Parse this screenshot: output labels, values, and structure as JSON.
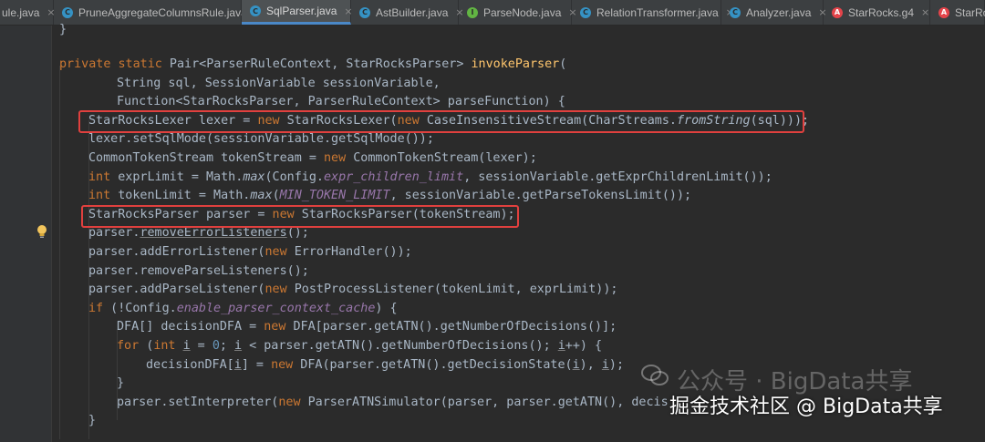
{
  "tabs": [
    {
      "label": "ule.java",
      "icon": "java-class-icon",
      "active": false
    },
    {
      "label": "PruneAggregateColumnsRule.java",
      "icon": "java-class-icon",
      "active": false
    },
    {
      "label": "SqlParser.java",
      "icon": "java-class-icon",
      "active": true
    },
    {
      "label": "AstBuilder.java",
      "icon": "java-class-icon",
      "active": false
    },
    {
      "label": "ParseNode.java",
      "icon": "java-interface-icon",
      "active": false
    },
    {
      "label": "RelationTransformer.java",
      "icon": "java-class-icon",
      "active": false
    },
    {
      "label": "Analyzer.java",
      "icon": "java-class-icon",
      "active": false
    },
    {
      "label": "StarRocks.g4",
      "icon": "antlr-icon",
      "active": false
    },
    {
      "label": "StarRoc",
      "icon": "antlr-icon",
      "active": false
    }
  ],
  "colors": {
    "keyword": "#cc7832",
    "method_decl": "#ffc66d",
    "static_field": "#9876aa",
    "text": "#a9b7c6",
    "highlight_box": "#e0403e",
    "background": "#2b2b2b"
  },
  "code": {
    "l00": [
      "}"
    ],
    "l02": [
      "private static",
      " Pair<ParserRuleContext, StarRocksParser> ",
      "invokeParser",
      "("
    ],
    "l03": [
      "String sql, SessionVariable sessionVariable,"
    ],
    "l04": [
      "Function<StarRocksParser, ParserRuleContext> parseFunction) {"
    ],
    "l05": [
      "StarRocksLexer lexer = ",
      "new",
      " StarRocksLexer(",
      "new",
      " CaseInsensitiveStream(CharStreams.",
      "fromString",
      "(sql)));"
    ],
    "l06": [
      "lexer.setSqlMode(sessionVariable.getSqlMode());"
    ],
    "l07": [
      "CommonTokenStream tokenStream = ",
      "new",
      " CommonTokenStream(lexer);"
    ],
    "l08": [
      "int",
      " exprLimit = Math.",
      "max",
      "(Config.",
      "expr_children_limit",
      ", sessionVariable.getExprChildrenLimit());"
    ],
    "l09": [
      "int",
      " tokenLimit = Math.",
      "max",
      "(",
      "MIN_TOKEN_LIMIT",
      ", sessionVariable.getParseTokensLimit());"
    ],
    "l10": [
      "StarRocksParser parser = ",
      "new",
      " StarRocksParser(tokenStream);"
    ],
    "l11": [
      "parser.",
      "removeErrorListeners",
      "();"
    ],
    "l12": [
      "parser.addErrorListener(",
      "new",
      " ErrorHandler());"
    ],
    "l13": [
      "parser.removeParseListeners();"
    ],
    "l14": [
      "parser.addParseListener(",
      "new",
      " PostProcessListener(tokenLimit, exprLimit));"
    ],
    "l15": [
      "if",
      " (!Config.",
      "enable_parser_context_cache",
      ") {"
    ],
    "l16": [
      "DFA[] decisionDFA = ",
      "new",
      " DFA[parser.getATN().getNumberOfDecisions()];"
    ],
    "l17": [
      "for",
      " (",
      "int",
      " ",
      "i",
      " = ",
      "0",
      "; ",
      "i",
      " < parser.getATN().getNumberOfDecisions(); ",
      "i",
      "++) {"
    ],
    "l18": [
      "decisionDFA[",
      "i",
      "] = ",
      "new",
      " DFA(parser.getATN().getDecisionState(",
      "i",
      "), ",
      "i",
      ");"
    ],
    "l19": [
      "}"
    ],
    "l20": [
      "parser.setInterpreter(",
      "new",
      " ParserATNSimulator(parser, parser.getATN(), decis"
    ],
    "l21": [
      "}"
    ]
  },
  "watermark": {
    "gray": "公众号 · BigData共享",
    "white": "掘金技术社区 @ BigData共享"
  }
}
